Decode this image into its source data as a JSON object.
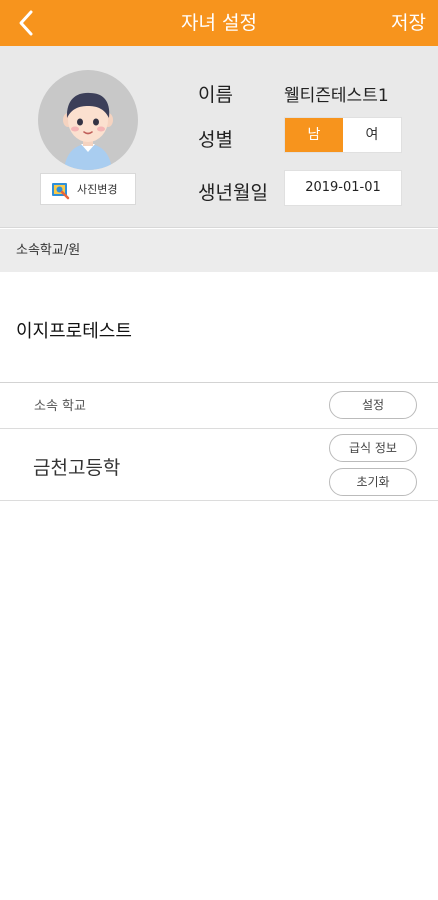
{
  "header": {
    "title": "자녀 설정",
    "save_label": "저장",
    "background_color": "#f7941d"
  },
  "profile": {
    "photo_button_label": "사진변경",
    "name_label": "이름",
    "name_value": "웰티즌테스트1",
    "gender_label": "성별",
    "gender_options": [
      "남",
      "여"
    ],
    "gender_selected": "남",
    "birth_label": "생년월일",
    "birth_value": "2019-01-01"
  },
  "organization": {
    "section_label": "소속학교/원",
    "org_name": "이지프로테스트"
  },
  "school": {
    "label": "소속 학교",
    "set_button": "설정",
    "school_name": "금천고등학",
    "meal_info_button": "급식 정보",
    "reset_button": "초기화"
  }
}
